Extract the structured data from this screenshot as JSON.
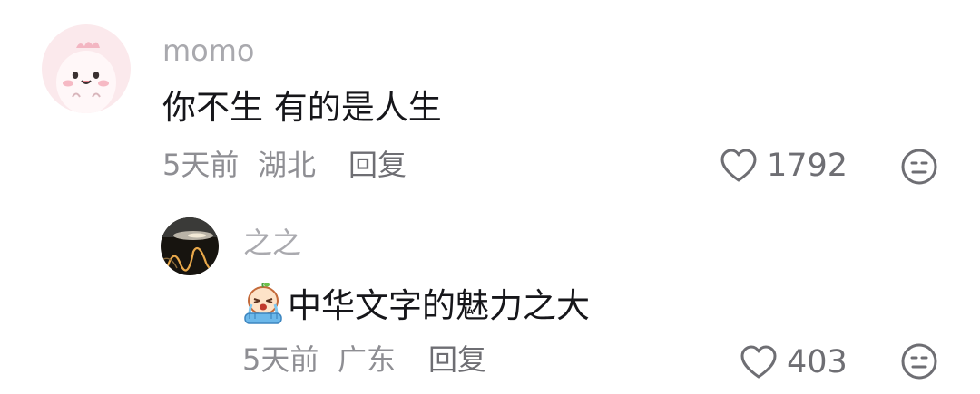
{
  "comments": [
    {
      "username": "momo",
      "text": "你不生 有的是人生",
      "time": "5天前",
      "location": "湖北",
      "reply_label": "回复",
      "likes": "1792",
      "avatar_icon": "cute-pink-creature-avatar"
    }
  ],
  "replies": [
    {
      "username": "之之",
      "emoji_icon": "crying-emoji-icon",
      "text": "中华文字的魅力之大",
      "time": "5天前",
      "location": "广东",
      "reply_label": "回复",
      "likes": "403",
      "avatar_icon": "sunset-photo-avatar"
    }
  ],
  "icons": {
    "like": "heart-outline-icon",
    "dislike": "neutral-face-icon"
  },
  "colors": {
    "username": "#a9a9ae",
    "text": "#16161a",
    "meta": "#8e8e93",
    "icon": "#6e6e73"
  }
}
